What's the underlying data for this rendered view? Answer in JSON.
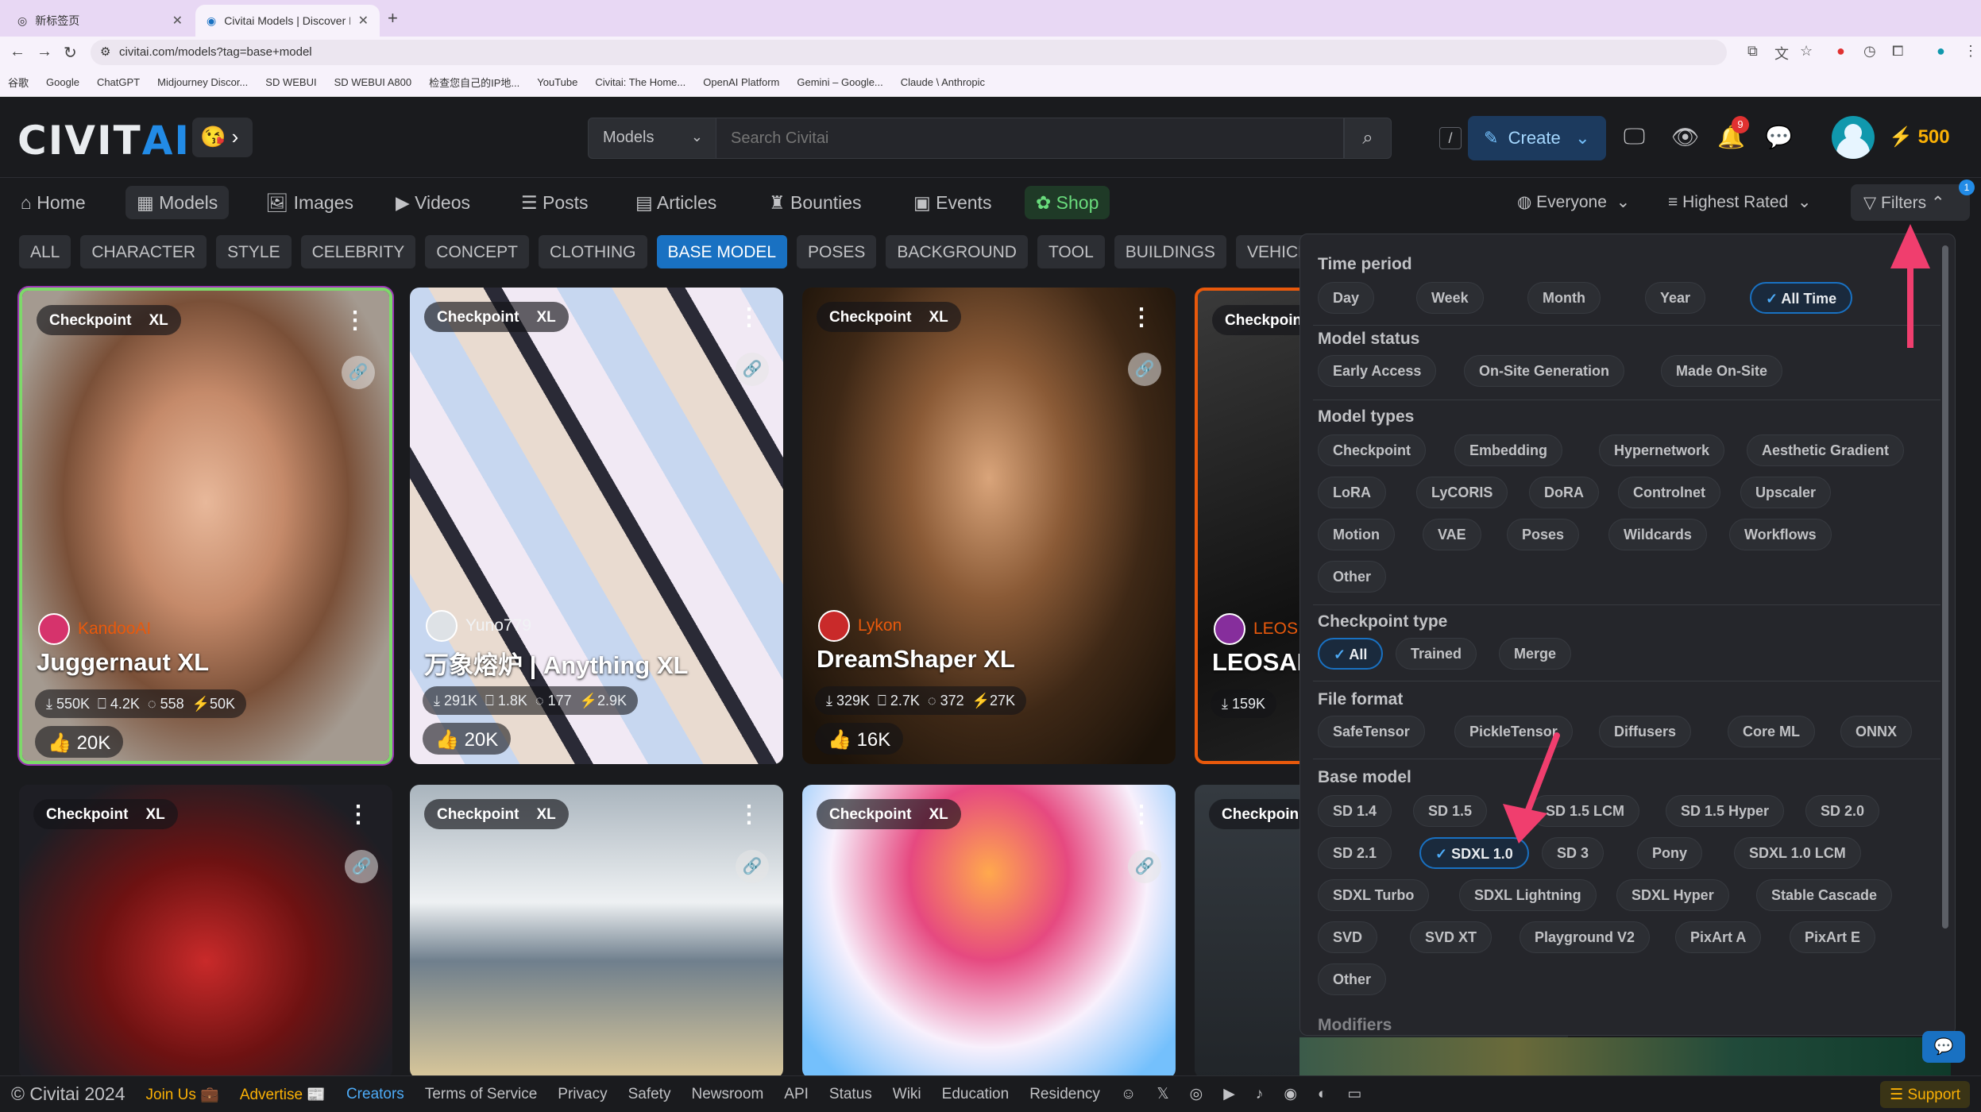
{
  "browser": {
    "tabs": [
      {
        "title": "新标签页"
      },
      {
        "title": "Civitai Models | Discover Fre"
      }
    ],
    "url": "civitai.com/models?tag=base+model",
    "bookmarks": [
      "谷歌",
      "Google",
      "ChatGPT",
      "Midjourney Discor...",
      "SD WEBUI",
      "SD WEBUI A800",
      "检查您自己的IP地...",
      "YouTube",
      "Civitai: The Home...",
      "OpenAI Platform",
      "Gemini – Google...",
      "Claude \\ Anthropic"
    ]
  },
  "header": {
    "logo_a": "CIVIT",
    "logo_b": "AI",
    "search_category": "Models",
    "search_placeholder": "Search Civitai",
    "search_shortcut": "/",
    "create_label": "Create",
    "notifications_count": "9",
    "buzz": "500"
  },
  "nav": {
    "items": [
      "Home",
      "Models",
      "Images",
      "Videos",
      "Posts",
      "Articles",
      "Bounties",
      "Events",
      "Shop"
    ],
    "audience": "Everyone",
    "sort": "Highest Rated",
    "filters_label": "Filters",
    "filters_count": "1"
  },
  "tags": [
    "ALL",
    "CHARACTER",
    "STYLE",
    "CELEBRITY",
    "CONCEPT",
    "CLOTHING",
    "BASE MODEL",
    "POSES",
    "BACKGROUND",
    "TOOL",
    "BUILDINGS",
    "VEHICLE"
  ],
  "active_tag": "BASE MODEL",
  "cards": [
    {
      "type": "Checkpoint",
      "base": "XL",
      "author": "KandooAI",
      "title": "Juggernaut XL",
      "downloads": "550K",
      "saves": "4.2K",
      "comments": "558",
      "buzz": "50K",
      "likes": "20K"
    },
    {
      "type": "Checkpoint",
      "base": "XL",
      "author": "Yuno779",
      "title": "万象熔炉 | Anything XL",
      "downloads": "291K",
      "saves": "1.8K",
      "comments": "177",
      "buzz": "2.9K",
      "likes": "20K"
    },
    {
      "type": "Checkpoint",
      "base": "XL",
      "author": "Lykon",
      "title": "DreamShaper XL",
      "downloads": "329K",
      "saves": "2.7K",
      "comments": "372",
      "buzz": "27K",
      "likes": "16K"
    },
    {
      "type": "Checkpoin",
      "base": "",
      "author": "LEOS",
      "title": "LEOSAM",
      "downloads": "159K",
      "saves": "",
      "comments": "",
      "buzz": "",
      "likes": ""
    },
    {
      "type": "Checkpoint",
      "base": "XL"
    },
    {
      "type": "Checkpoint",
      "base": "XL"
    },
    {
      "type": "Checkpoint",
      "base": "XL"
    },
    {
      "type": "Checkpoin",
      "base": ""
    }
  ],
  "filters": {
    "time_period": {
      "label": "Time period",
      "options": [
        "Day",
        "Week",
        "Month",
        "Year",
        "All Time"
      ],
      "selected": "All Time"
    },
    "model_status": {
      "label": "Model status",
      "options": [
        "Early Access",
        "On-Site Generation",
        "Made On-Site"
      ]
    },
    "model_types": {
      "label": "Model types",
      "options": [
        "Checkpoint",
        "Embedding",
        "Hypernetwork",
        "Aesthetic Gradient",
        "LoRA",
        "LyCORIS",
        "DoRA",
        "Controlnet",
        "Upscaler",
        "Motion",
        "VAE",
        "Poses",
        "Wildcards",
        "Workflows",
        "Other"
      ]
    },
    "checkpoint_type": {
      "label": "Checkpoint type",
      "options": [
        "All",
        "Trained",
        "Merge"
      ],
      "selected": "All"
    },
    "file_format": {
      "label": "File format",
      "options": [
        "SafeTensor",
        "PickleTensor",
        "Diffusers",
        "Core ML",
        "ONNX"
      ]
    },
    "base_model": {
      "label": "Base model",
      "options": [
        "SD 1.4",
        "SD 1.5",
        "SD 1.5 LCM",
        "SD 1.5 Hyper",
        "SD 2.0",
        "SD 2.1",
        "SDXL 1.0",
        "SD 3",
        "Pony",
        "SDXL 1.0 LCM",
        "SDXL Turbo",
        "SDXL Lightning",
        "SDXL Hyper",
        "Stable Cascade",
        "SVD",
        "SVD XT",
        "Playground V2",
        "PixArt A",
        "PixArt E",
        "Other"
      ],
      "selected": "SDXL 1.0"
    },
    "next_section_partial": "Modifiers"
  },
  "footer": {
    "copyright": "© Civitai 2024",
    "links": [
      "Join Us 💼",
      "Advertise 📰",
      "Creators",
      "Terms of Service",
      "Privacy",
      "Safety",
      "Newsroom",
      "API",
      "Status",
      "Wiki",
      "Education",
      "Residency"
    ],
    "support": "Support"
  },
  "colors": {
    "accent": "#1971c2",
    "shop": "#69db7c",
    "buzz": "#fab005",
    "annotation_arrow": "#f03e6e"
  }
}
